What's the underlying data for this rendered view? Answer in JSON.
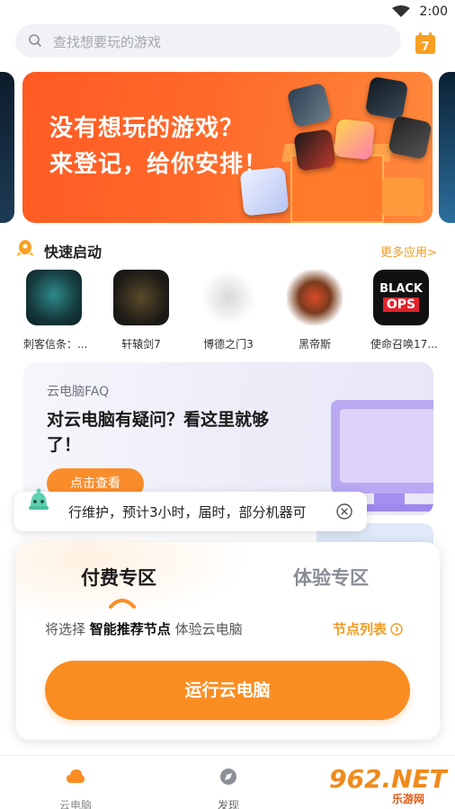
{
  "status_bar": {
    "time": "2:00"
  },
  "search": {
    "placeholder": "查找想要玩的游戏"
  },
  "calendar": {
    "day": "7"
  },
  "banner": {
    "line1": "没有想玩的游戏？",
    "line2": "来登记，给你安排！"
  },
  "quick_launch": {
    "title": "快速启动",
    "more": "更多应用>",
    "games": [
      {
        "name": "刺客信条：..."
      },
      {
        "name": "轩辕剑7"
      },
      {
        "name": "博德之门3"
      },
      {
        "name": "黑帝斯"
      },
      {
        "name": "使命召唤17..."
      }
    ],
    "black_ops_text": [
      "BLACK",
      "OPS"
    ]
  },
  "faq": {
    "label": "云电脑FAQ",
    "question": "对云电脑有疑问？看这里就够了！",
    "button": "点击查看"
  },
  "notice": {
    "text": "行维护，预计3小时，届时，部分机器可"
  },
  "sheet": {
    "tabs": [
      "付费专区",
      "体验专区"
    ],
    "node_prefix": "将选择",
    "node_bold": "智能推荐节点",
    "node_suffix": "体验云电脑",
    "node_list": "节点列表",
    "run_button": "运行云电脑"
  },
  "nav": {
    "items": [
      "云电脑",
      "发现"
    ]
  },
  "watermark": {
    "big": "962.NET",
    "small": "乐游网"
  },
  "colors": {
    "accent": "#fa8d22",
    "link": "#f39b21",
    "banner": "#ff6a2a"
  }
}
